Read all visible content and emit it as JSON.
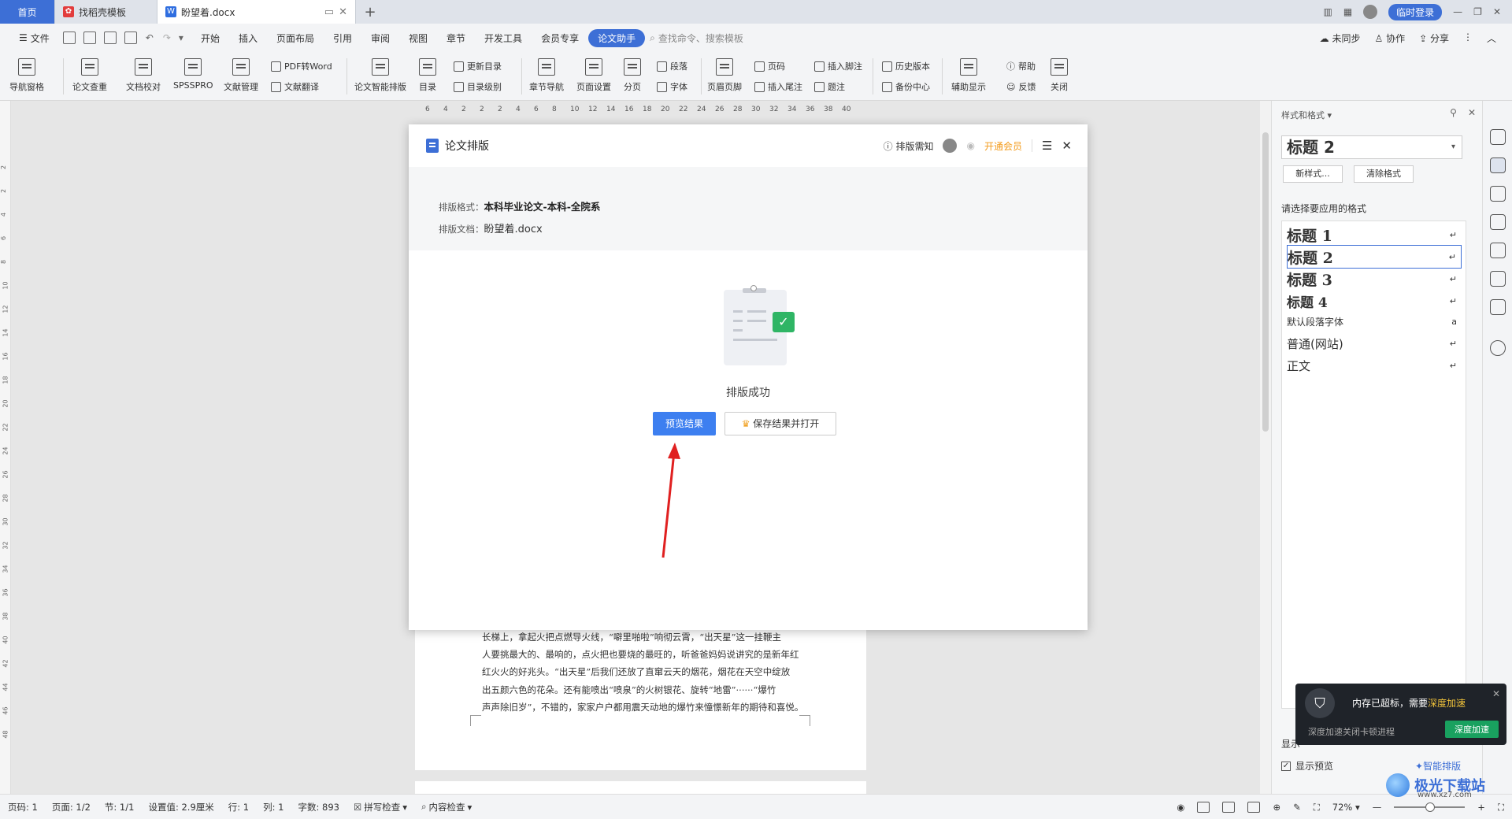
{
  "tabs": {
    "home": "首页",
    "template": "找稻壳模板",
    "doc": "盼望着.docx"
  },
  "titlebar": {
    "login": "临时登录"
  },
  "menu": {
    "items": [
      "开始",
      "插入",
      "页面布局",
      "引用",
      "审阅",
      "视图",
      "章节",
      "开发工具",
      "会员专享",
      "论文助手"
    ],
    "file": "文件",
    "search_placeholder": "查找命令、搜索模板",
    "right": [
      "未同步",
      "协作",
      "分享"
    ]
  },
  "ribbon": {
    "nav_pane": "导航窗格",
    "check": "论文查重",
    "proofread": "文档校对",
    "spss": "SPSSPRO",
    "refmgr": "文献管理",
    "pdf2word": "PDF转Word",
    "reftrans": "文献翻译",
    "smartformat": "论文智能排版",
    "toc": "目录",
    "update_toc": "更新目录",
    "toc_level": "目录级别",
    "chapter_nav": "章节导航",
    "page_setup": "页面设置",
    "section": "分页",
    "paragraph": "段落",
    "font": "字体",
    "header_footer": "页眉页脚",
    "page_num": "页码",
    "footnote": "插入脚注",
    "endnote": "插入尾注",
    "caption": "题注",
    "history": "历史版本",
    "backup": "备份中心",
    "aux_display": "辅助显示",
    "help": "帮助",
    "feedback": "反馈",
    "close": "关闭"
  },
  "ruler": [
    "6",
    "4",
    "2",
    "2",
    "2",
    "4",
    "6",
    "8",
    "10",
    "12",
    "14",
    "16",
    "18",
    "20",
    "22",
    "24",
    "26",
    "28",
    "30",
    "32",
    "34",
    "36",
    "38",
    "40"
  ],
  "vruler": [
    "2",
    "2",
    "4",
    "6",
    "8",
    "10",
    "12",
    "14",
    "16",
    "18",
    "20",
    "22",
    "24",
    "26",
    "28",
    "30",
    "32",
    "34",
    "36",
    "38",
    "40",
    "42",
    "44",
    "46",
    "48"
  ],
  "document": {
    "lines": [
      "长梯上，拿起火把点燃导火线，“噼里啪啦”响彻云霄，“出天星”这一挂鞭主",
      "人要挑最大的、最响的，点火把也要烧的最旺的，听爸爸妈妈说讲究的是新年红",
      "红火火的好兆头。“出天星”后我们还放了直窜云天的烟花，烟花在天空中绽放",
      "出五颜六色的花朵。还有能喷出“喷泉”的火树银花、旋转“地雷”······“爆竹",
      "声声除旧岁”，不错的，家家户户都用震天动地的爆竹来憧憬新年的期待和喜悦。"
    ]
  },
  "dialog": {
    "title": "论文排版",
    "needs": "排版需知",
    "vip": "开通会员",
    "format_label": "排版格式：",
    "format_value": "本科毕业论文-本科-全院系",
    "doc_label": "排版文档：",
    "doc_value": "盼望着.docx",
    "success": "排版成功",
    "preview_btn": "预览结果",
    "save_btn": "保存结果并打开"
  },
  "rightpanel": {
    "header": "样式和格式",
    "current_style": "标题 2",
    "new_style": "新样式...",
    "clear_format": "清除格式",
    "choose_label": "请选择要应用的格式",
    "styles": [
      "标题 1",
      "标题 2",
      "标题 3",
      "标题 4",
      "默认段落字体",
      "普通(网站)",
      "正文"
    ],
    "show_preview": "显示预览",
    "smart": "智能排版",
    "show_partial": "显示"
  },
  "toast": {
    "msg_prefix": "内存已超标，需要",
    "msg_hl": "深度加速",
    "sub": "深度加速关闭卡顿进程",
    "btn": "深度加速"
  },
  "status": {
    "page": "页码: 1",
    "pages": "页面: 1/2",
    "section": "节: 1/1",
    "setting": "设置值: 2.9厘米",
    "row": "行: 1",
    "col": "列: 1",
    "words": "字数: 893",
    "spell": "拼写检查",
    "content_check": "内容检查",
    "zoom": "72%"
  },
  "watermark": {
    "brand": "极光下载站",
    "url": "www.xz7.com"
  }
}
